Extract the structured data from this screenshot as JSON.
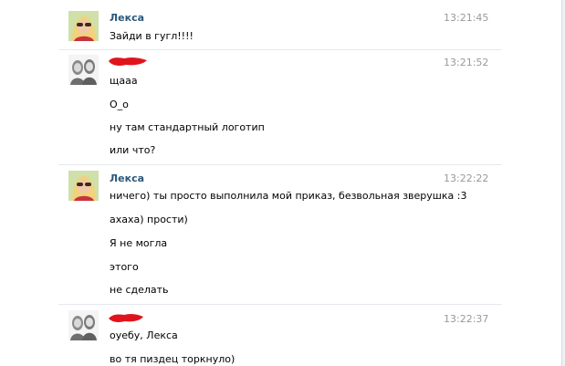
{
  "messages": [
    {
      "author": "Лекса",
      "avatar": "blonde-girl-avatar",
      "time": "13:21:45",
      "lines": [
        "Зайди в гугл!!!!"
      ]
    },
    {
      "author": "",
      "avatar": "two-girls-avatar",
      "time": "13:21:52",
      "lines": [
        "щааа",
        "О_о",
        "ну там стандартный логотип",
        "или что?"
      ]
    },
    {
      "author": "Лекса",
      "avatar": "blonde-girl-avatar",
      "time": "13:22:22",
      "lines": [
        "ничего) ты просто выполнила мой приказ, безвольная зверушка :3",
        "ахаха) прости)",
        "Я не могла",
        "этого",
        "не сделать"
      ]
    },
    {
      "author": "",
      "avatar": "two-girls-avatar",
      "time": "13:22:37",
      "lines": [
        "оуебу, Лекса",
        "во тя пиздец торкнуло)"
      ]
    }
  ],
  "colors": {
    "author_link": "#2b587a",
    "timestamp": "#999999",
    "redaction": "#e0141d",
    "divider": "#e6e9ee"
  }
}
